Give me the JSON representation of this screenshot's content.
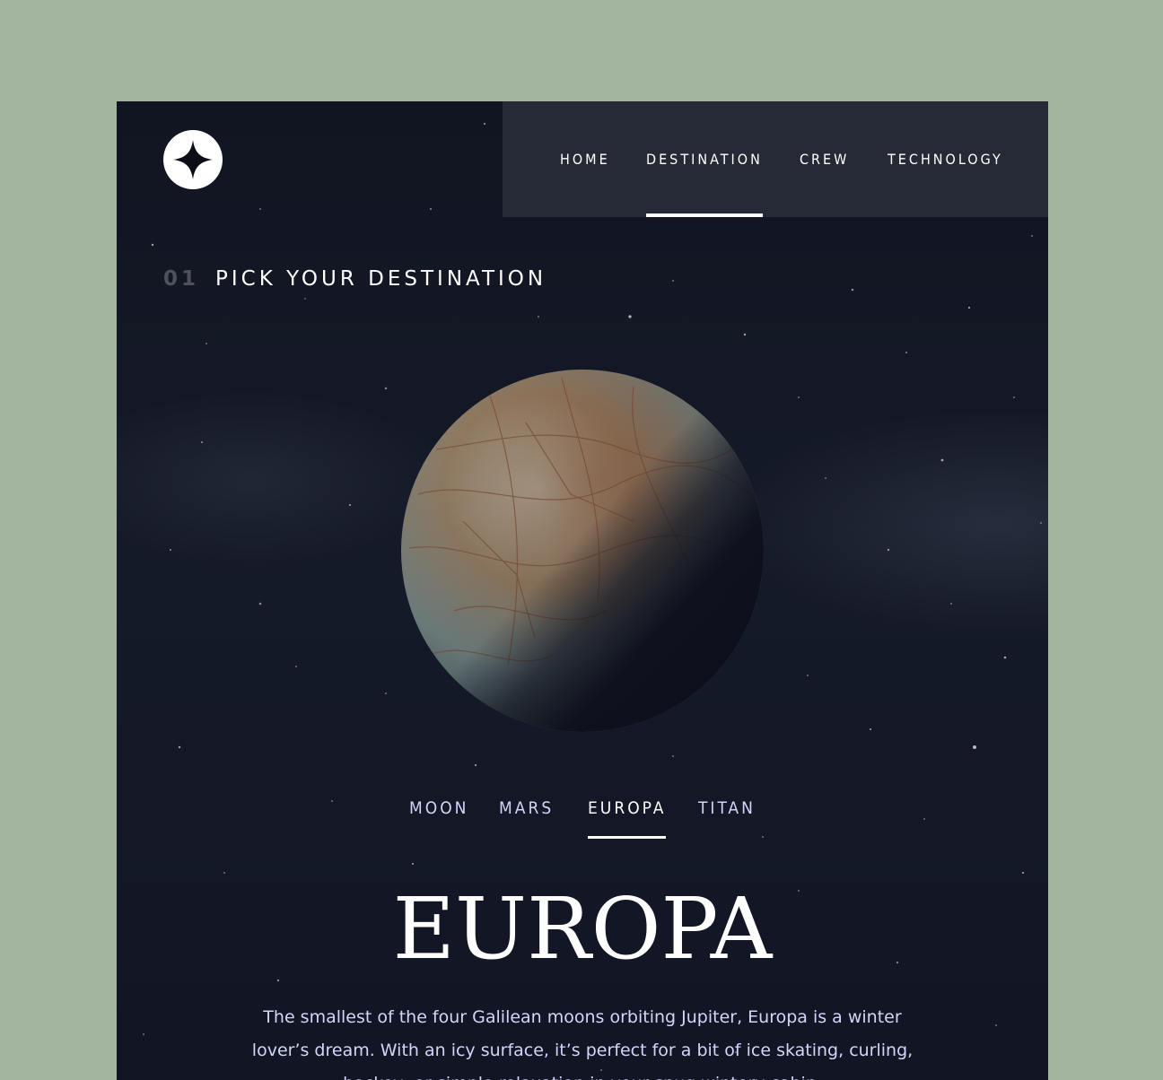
{
  "nav": {
    "items": [
      {
        "label": "HOME",
        "active": false
      },
      {
        "label": "DESTINATION",
        "active": true
      },
      {
        "label": "CREW",
        "active": false
      },
      {
        "label": "TECHNOLOGY",
        "active": false
      }
    ]
  },
  "heading": {
    "number": "01",
    "text": "PICK YOUR DESTINATION"
  },
  "tabs": [
    {
      "label": "MOON",
      "active": false
    },
    {
      "label": "MARS",
      "active": false
    },
    {
      "label": "EUROPA",
      "active": true
    },
    {
      "label": "TITAN",
      "active": false
    }
  ],
  "destination": {
    "name": "EUROPA",
    "description": "The smallest of the four Galilean moons orbiting Jupiter, Europa is a winter lover’s dream. With an icy surface, it’s perfect for a bit of ice skating, curling, hockey, or simple relaxation in your snug wintery cabin."
  },
  "icons": {
    "logo": "star-logo-icon",
    "planet": "europa-planet-image"
  },
  "colors": {
    "page_background": "#a3b59f",
    "space_background": "#121624",
    "nav_background": "#282c38",
    "text_primary": "#ffffff",
    "text_secondary": "#d0d6f9"
  }
}
